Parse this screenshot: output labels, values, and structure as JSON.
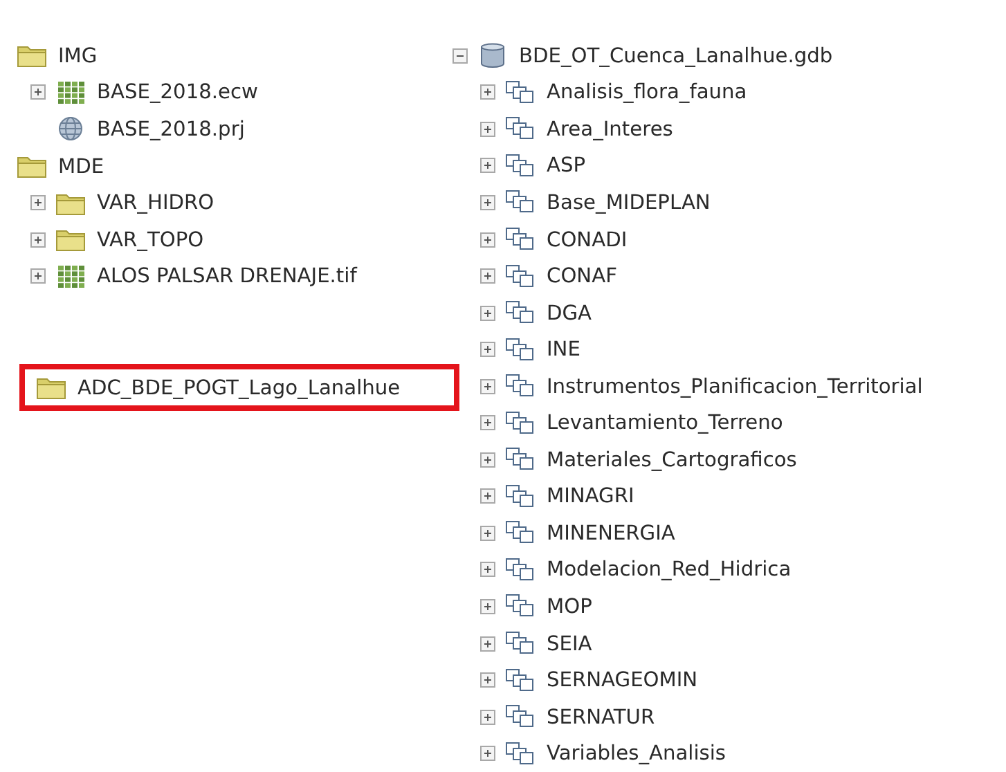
{
  "left_tree": [
    {
      "label": "IMG",
      "kind": "folder",
      "children": [
        {
          "label": "BASE_2018.ecw",
          "kind": "raster",
          "expanded": false
        },
        {
          "label": "BASE_2018.prj",
          "kind": "projection"
        }
      ]
    },
    {
      "label": "MDE",
      "kind": "folder",
      "children": [
        {
          "label": "VAR_HIDRO",
          "kind": "folder",
          "expanded": false
        },
        {
          "label": "VAR_TOPO",
          "kind": "folder",
          "expanded": false
        },
        {
          "label": "ALOS PALSAR DRENAJE.tif",
          "kind": "raster",
          "expanded": false
        }
      ]
    }
  ],
  "highlighted_item": {
    "label": "ADC_BDE_POGT_Lago_Lanalhue",
    "kind": "folder",
    "highlighted": true
  },
  "right_tree": [
    {
      "label": "BDE_OT_Cuenca_Lanalhue.gdb",
      "kind": "geodatabase",
      "expanded": true,
      "children": [
        {
          "label": "Analisis_flora_fauna",
          "kind": "feature_dataset",
          "expanded": false
        },
        {
          "label": "Area_Interes",
          "kind": "feature_dataset",
          "expanded": false
        },
        {
          "label": "ASP",
          "kind": "feature_dataset",
          "expanded": false
        },
        {
          "label": "Base_MIDEPLAN",
          "kind": "feature_dataset",
          "expanded": false
        },
        {
          "label": "CONADI",
          "kind": "feature_dataset",
          "expanded": false
        },
        {
          "label": "CONAF",
          "kind": "feature_dataset",
          "expanded": false
        },
        {
          "label": "DGA",
          "kind": "feature_dataset",
          "expanded": false
        },
        {
          "label": "INE",
          "kind": "feature_dataset",
          "expanded": false
        },
        {
          "label": "Instrumentos_Planificacion_Territorial",
          "kind": "feature_dataset",
          "expanded": false
        },
        {
          "label": "Levantamiento_Terreno",
          "kind": "feature_dataset",
          "expanded": false
        },
        {
          "label": "Materiales_Cartograficos",
          "kind": "feature_dataset",
          "expanded": false
        },
        {
          "label": "MINAGRI",
          "kind": "feature_dataset",
          "expanded": false
        },
        {
          "label": "MINENERGIA",
          "kind": "feature_dataset",
          "expanded": false
        },
        {
          "label": "Modelacion_Red_Hidrica",
          "kind": "feature_dataset",
          "expanded": false
        },
        {
          "label": "MOP",
          "kind": "feature_dataset",
          "expanded": false
        },
        {
          "label": "SEIA",
          "kind": "feature_dataset",
          "expanded": false
        },
        {
          "label": "SERNAGEOMIN",
          "kind": "feature_dataset",
          "expanded": false
        },
        {
          "label": "SERNATUR",
          "kind": "feature_dataset",
          "expanded": false
        },
        {
          "label": "Variables_Analisis",
          "kind": "feature_dataset",
          "expanded": false
        }
      ]
    }
  ]
}
